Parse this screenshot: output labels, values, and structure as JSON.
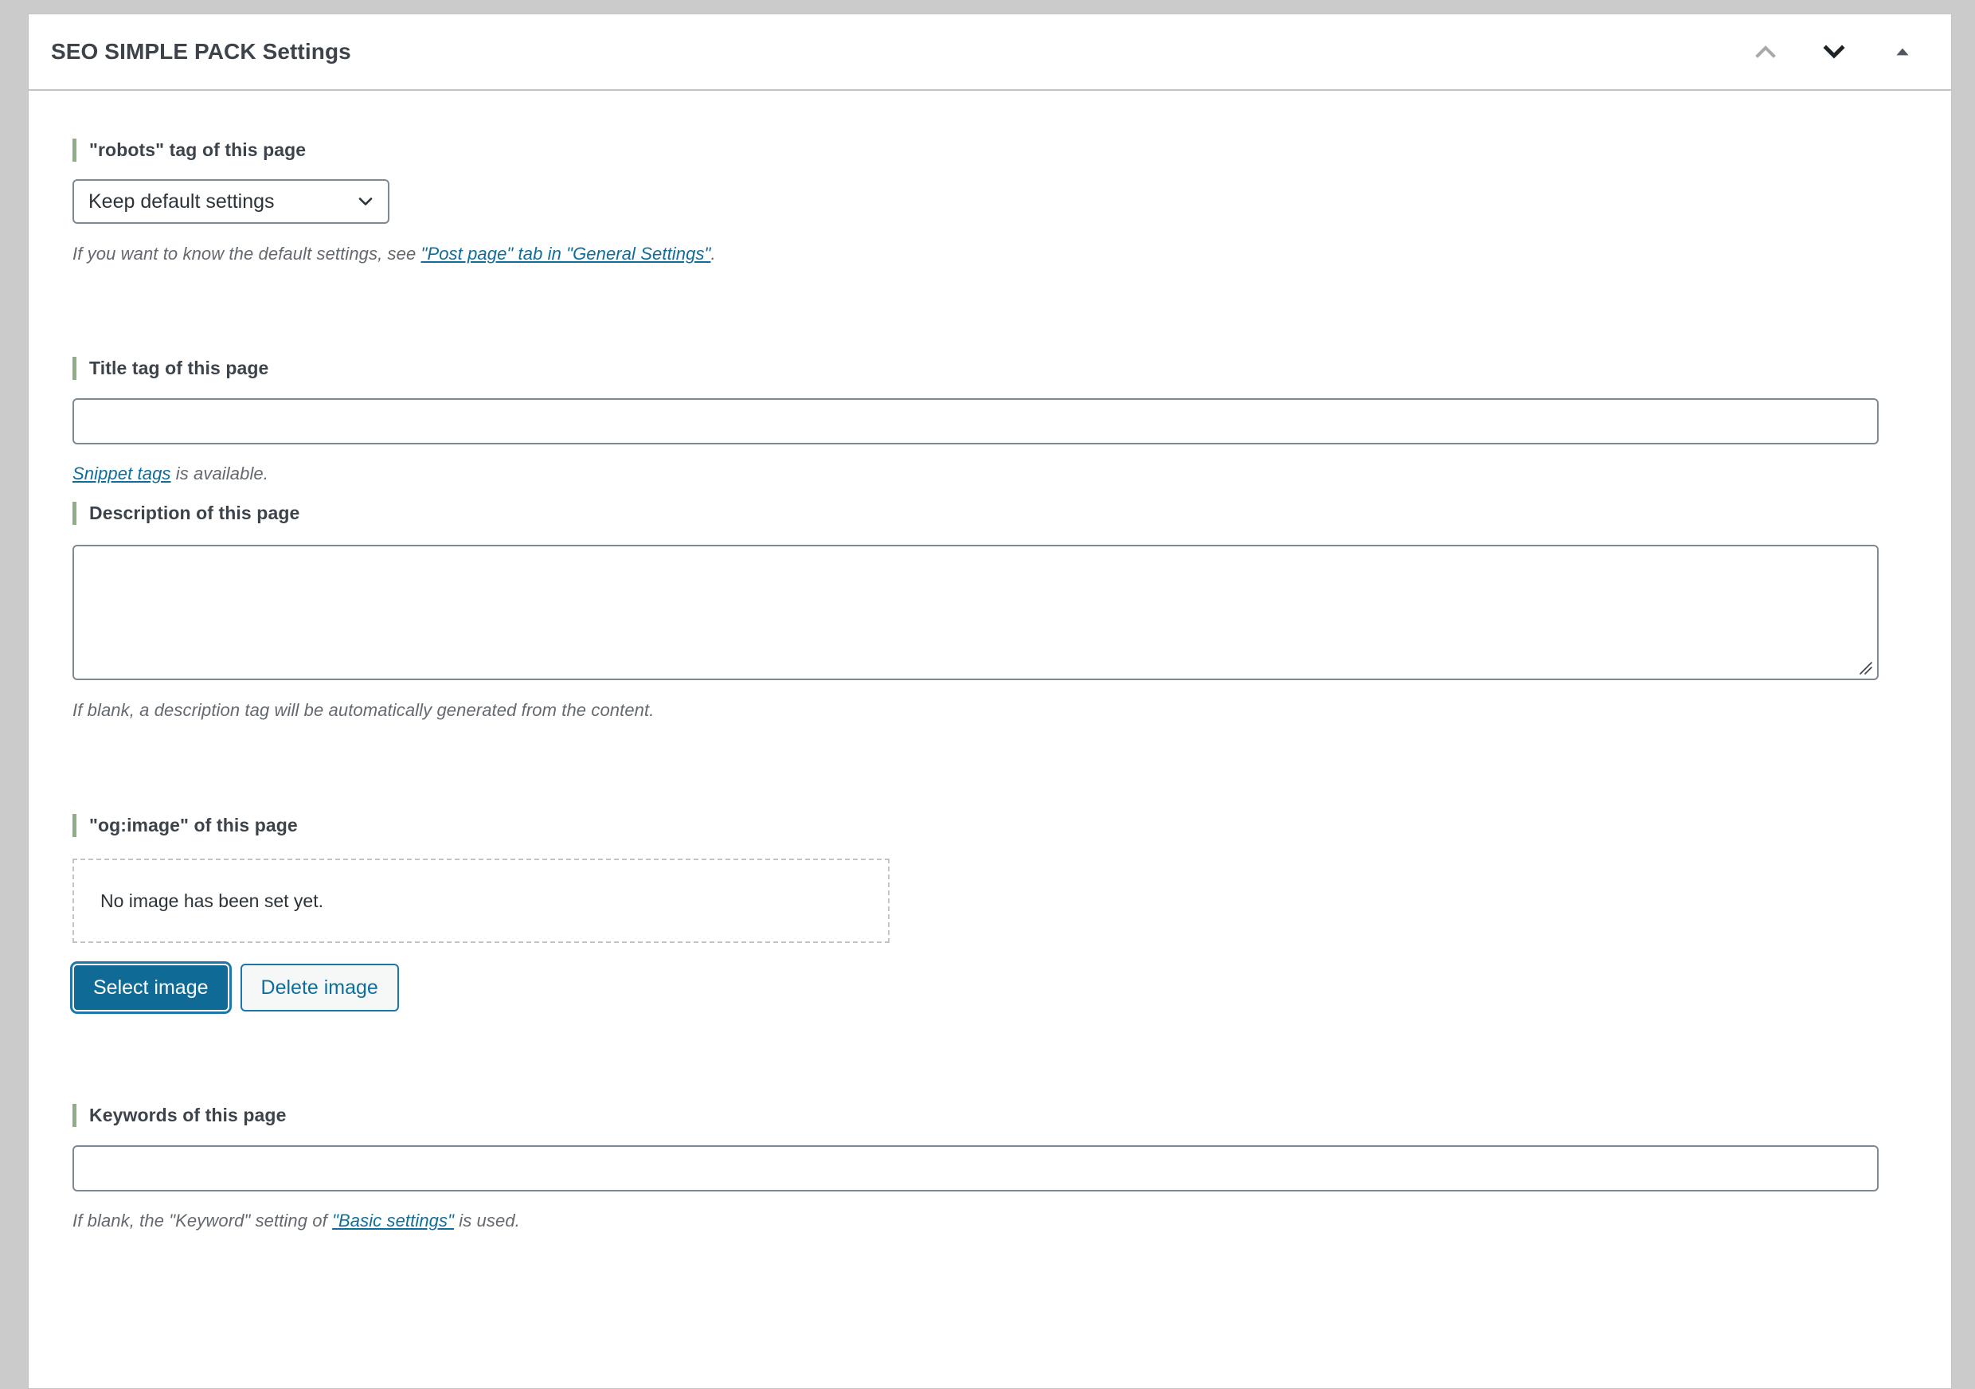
{
  "panel": {
    "title": "SEO SIMPLE PACK Settings",
    "header_actions": [
      {
        "name": "move-up-icon",
        "label": "Move up"
      },
      {
        "name": "move-down-icon",
        "label": "Move down"
      },
      {
        "name": "toggle-panel-icon",
        "label": "Toggle panel"
      }
    ]
  },
  "accent_color": "#8fae88",
  "link_color": "#0f6d9b",
  "primary_button_color": "#106a96",
  "fields": {
    "robots": {
      "heading": "\"robots\" tag of this page",
      "select_value": "Keep default settings",
      "options": [
        "Keep default settings"
      ],
      "help_prefix": "If you want to know the default settings, see ",
      "help_link": "\"Post page\" tab in \"General Settings\"",
      "help_suffix": "."
    },
    "title_tag": {
      "heading": "Title tag of this page",
      "value": "",
      "placeholder": "",
      "help_link": "Snippet tags",
      "help_suffix": " is available."
    },
    "description": {
      "heading": "Description of this page",
      "value": "",
      "placeholder": "",
      "help_text": "If blank, a description tag will be automatically generated from the content."
    },
    "og_image": {
      "heading": "\"og:image\" of this page",
      "placeholder_text": "No image has been set yet.",
      "select_button": "Select image",
      "delete_button": "Delete image"
    },
    "keywords": {
      "heading": "Keywords of this page",
      "value": "",
      "placeholder": "",
      "help_prefix": "If blank, the \"Keyword\" setting of ",
      "help_link": "\"Basic settings\"",
      "help_suffix": " is used."
    }
  }
}
